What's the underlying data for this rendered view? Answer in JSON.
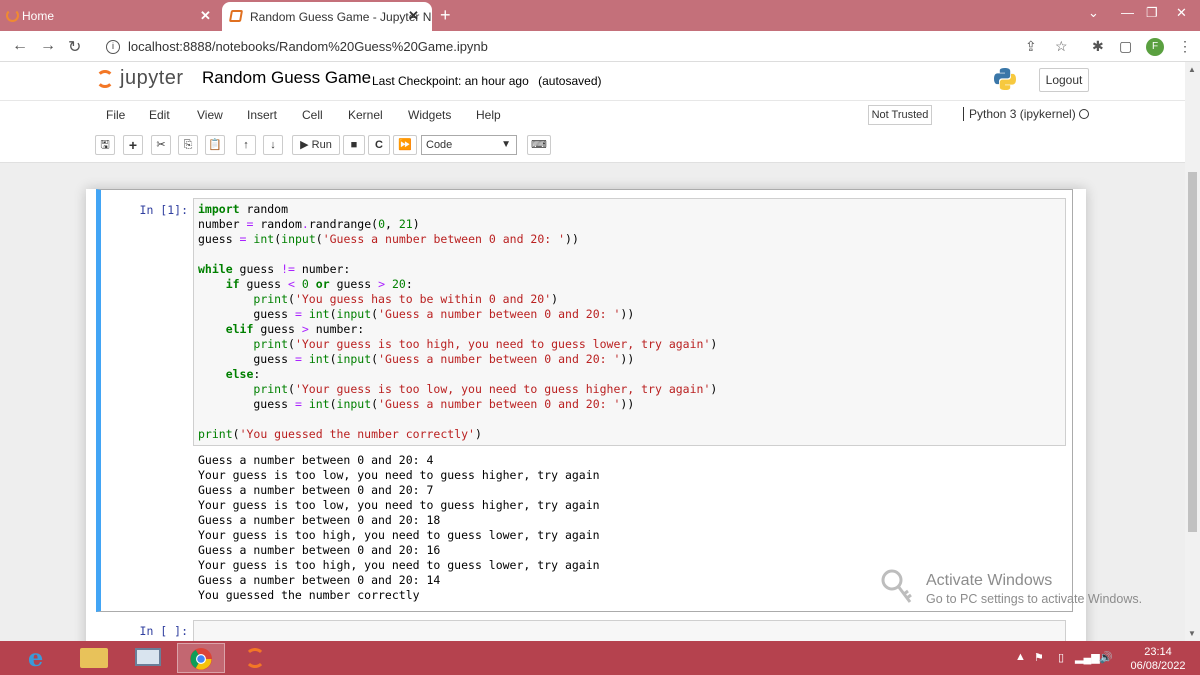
{
  "browser": {
    "tabs": [
      {
        "label": "Home",
        "active": false
      },
      {
        "label": "Random Guess Game - Jupyter N",
        "active": true
      }
    ],
    "new_tab": "+",
    "url": "localhost:8888/notebooks/Random%20Guess%20Game.ipynb",
    "profile_initial": "F"
  },
  "jupyter": {
    "logo_text": "jupyter",
    "notebook_name": "Random Guess Game",
    "checkpoint": "Last Checkpoint: an hour ago",
    "autosave": "(autosaved)",
    "logout_label": "Logout",
    "menu": [
      "File",
      "Edit",
      "View",
      "Insert",
      "Cell",
      "Kernel",
      "Widgets",
      "Help"
    ],
    "trust_label": "Not Trusted",
    "kernel_label": "Python 3 (ipykernel)",
    "toolbar": {
      "run_label": "Run",
      "cell_type": "Code"
    }
  },
  "cells": [
    {
      "prompt": "In [1]:",
      "output": "Guess a number between 0 and 20: 4\nYour guess is too low, you need to guess higher, try again\nGuess a number between 0 and 20: 7\nYour guess is too low, you need to guess higher, try again\nGuess a number between 0 and 20: 18\nYour guess is too high, you need to guess lower, try again\nGuess a number between 0 and 20: 16\nYour guess is too high, you need to guess lower, try again\nGuess a number between 0 and 20: 14\nYou guessed the number correctly"
    },
    {
      "prompt": "In [ ]:"
    }
  ],
  "watermark": {
    "title": "Activate Windows",
    "subtitle": "Go to PC settings to activate Windows."
  },
  "taskbar": {
    "time": "23:14",
    "date": "06/08/2022"
  },
  "colors": {
    "tab_strip": "#c4707a",
    "taskbar": "#b5424e",
    "cell_selected_border": "#42a5f5",
    "jupyter_orange": "#f37726"
  }
}
